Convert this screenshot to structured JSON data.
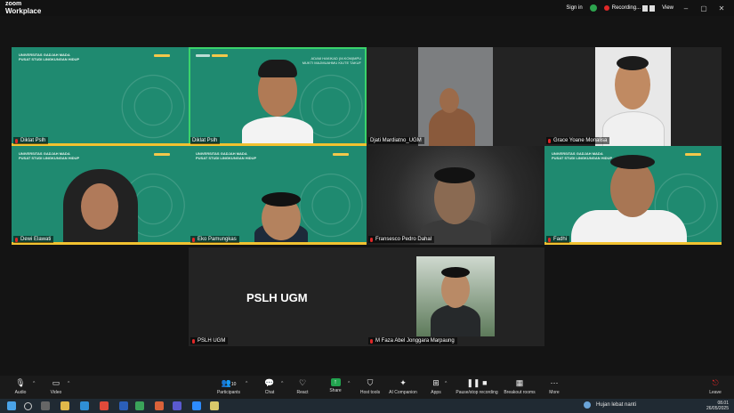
{
  "app": {
    "brand_line1": "zoom",
    "brand_line2": "Workplace"
  },
  "titlebar": {
    "sign_in": "Sign in",
    "recording": "Recording...",
    "view": "View"
  },
  "tiles": {
    "t1": {
      "name": "Diklat Pslh",
      "uni": "UNIVERSITAS GADJAH MADA\nPUSAT STUDI LINGKUNGAN HIDUP"
    },
    "t2": {
      "name": "Diklat Pslh",
      "caption_top": "ADAM HAKIKAD (M.KOM)MPU",
      "caption_mid": "MUKTI MAJMUAHMU KIUTE TAKUF"
    },
    "t3": {
      "name": "Djati Mardiatno_UGM"
    },
    "t4": {
      "name": "Grace Yoane Monalisa"
    },
    "t5": {
      "name": "Dewi Elawati",
      "uni": "UNIVERSITAS GADJAH MADA\nPUSAT STUDI LINGKUNGAN HIDUP"
    },
    "t6": {
      "name": "Eko Pamungkas",
      "uni": "UNIVERSITAS GADJAH MADA\nPUSAT STUDI LINGKUNGAN HIDUP"
    },
    "t7": {
      "name": "Fransesco Pedro Dahal"
    },
    "t8": {
      "name": "Fadhi",
      "uni": "UNIVERSITAS GADJAH MADA\nPUSAT STUDI LINGKUNGAN HIDUP"
    },
    "t9": {
      "name": "PSLH UGM",
      "big": "PSLH UGM"
    },
    "t10": {
      "name": "M Faza Abel Jonggara Marpaung"
    }
  },
  "toolbar": {
    "audio": "Audio",
    "video": "Video",
    "participants": "Participants",
    "participants_count": "10",
    "chat": "Chat",
    "react": "React",
    "share": "Share",
    "host_tools": "Host tools",
    "ai_companion": "AI Companion",
    "apps": "Apps",
    "pause_recording": "Pause/stop recording",
    "breakout_rooms": "Breakout rooms",
    "more": "More",
    "leave": "Leave"
  },
  "taskbar": {
    "weather": "Hujan lebat nanti",
    "time": "08.01",
    "date": "26/05/2025"
  },
  "colors": {
    "tile_green": "#1f8a70",
    "accent_yellow": "#f2c230",
    "active_border": "#3ad36b",
    "rec_red": "#e02828"
  }
}
